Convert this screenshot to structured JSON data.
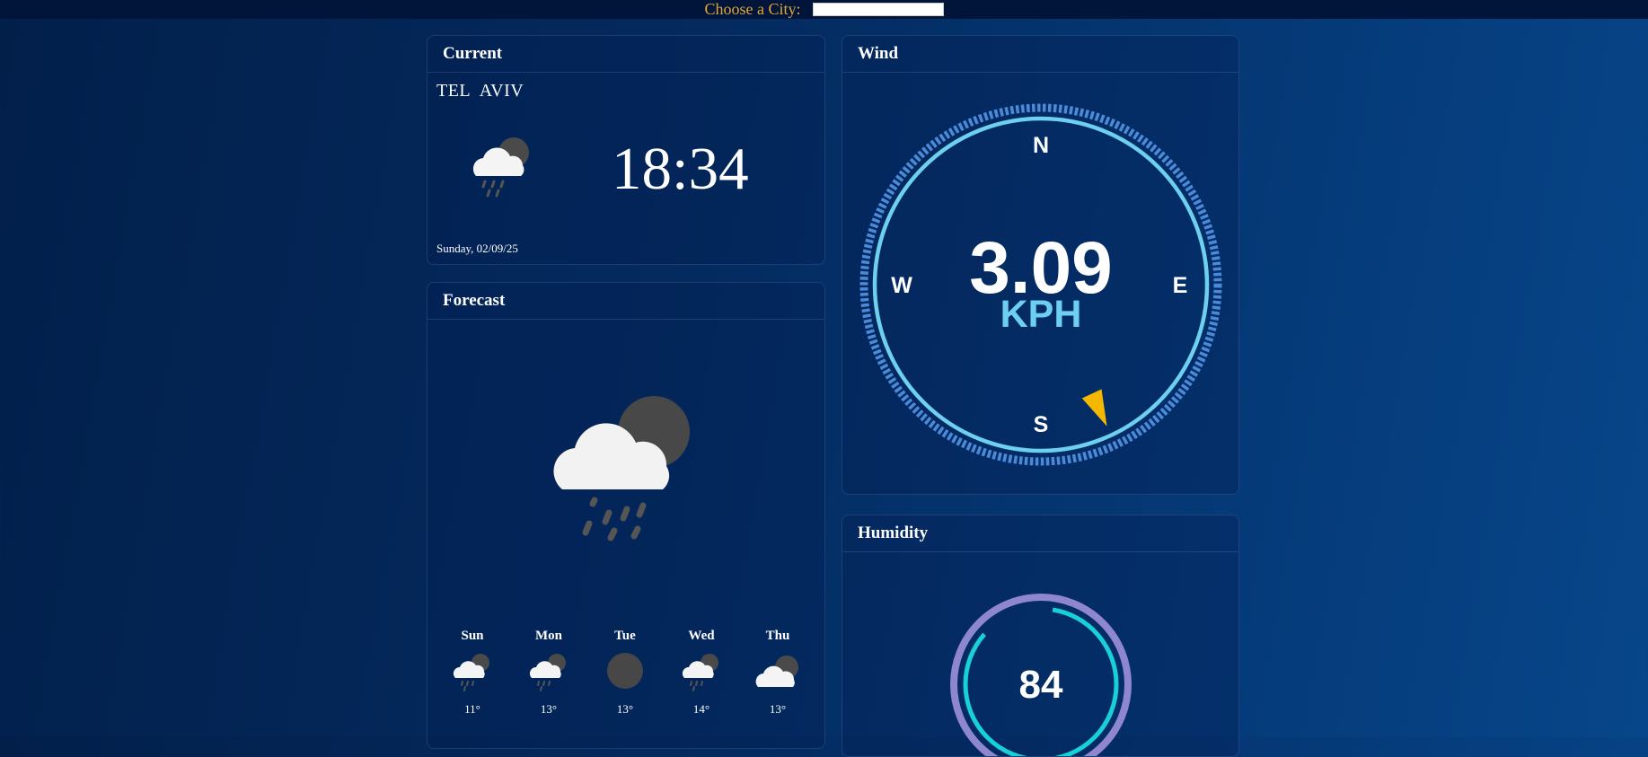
{
  "topbar": {
    "label": "Choose a City:",
    "input_value": ""
  },
  "current": {
    "title": "Current",
    "city": "TEL AVIV",
    "time": "18:34",
    "date": "Sunday, 02/09/25",
    "icon": "cloud-moon-rain-icon"
  },
  "forecast": {
    "title": "Forecast",
    "icon": "cloud-moon-rain-icon",
    "days": [
      {
        "name": "Sun",
        "temp": "11°",
        "icon": "cloud-moon-rain-icon"
      },
      {
        "name": "Mon",
        "temp": "13°",
        "icon": "cloud-moon-rain-icon"
      },
      {
        "name": "Tue",
        "temp": "13°",
        "icon": "moon-icon"
      },
      {
        "name": "Wed",
        "temp": "14°",
        "icon": "cloud-moon-rain-icon"
      },
      {
        "name": "Thu",
        "temp": "13°",
        "icon": "cloud-moon-icon"
      }
    ]
  },
  "wind": {
    "title": "Wind",
    "speed": "3.09",
    "unit": "KPH",
    "direction_deg": 155,
    "north": "N",
    "south": "S",
    "east": "E",
    "west": "W"
  },
  "humidity": {
    "title": "Humidity",
    "value": "84",
    "percent": 84
  },
  "colors": {
    "accent_label": "#e0a83a",
    "compass_ring": "#6ed0f0",
    "compass_dots": "#4a8ad8",
    "needle": "#f5b800",
    "humidity_outer": "#8f86d0",
    "humidity_inner": "#18d0d8"
  }
}
